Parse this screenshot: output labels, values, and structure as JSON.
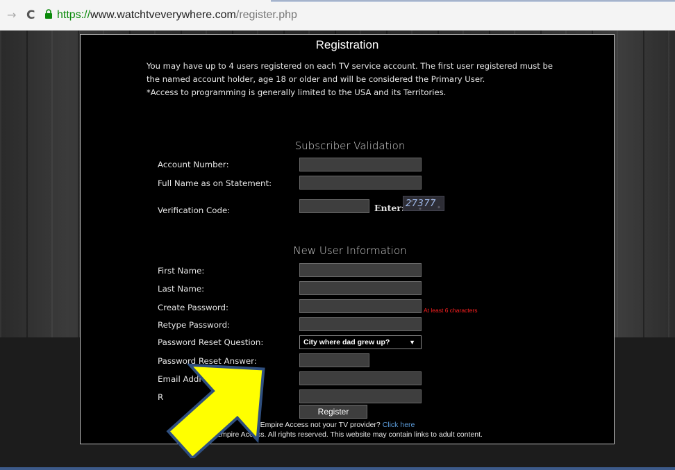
{
  "browser": {
    "url_protocol": "https://",
    "url_host": "www.watchtveverywhere.com",
    "url_path": "/register.php",
    "forward_glyph": "→",
    "reload_glyph": "C",
    "lock_icon": "lock-icon"
  },
  "page": {
    "title": "Registration",
    "intro_lines": [
      "You may have up to 4 users registered on each TV service account. The first user registered must be",
      "the named account holder, age 18 or older and will be considered the Primary User.",
      "*Access to programming is generally limited to the USA and its Territories."
    ],
    "subscriber_section": {
      "heading": "Subscriber Validation",
      "account_number_label": "Account Number:",
      "account_number_value": "",
      "full_name_label": "Full Name as on Statement:",
      "full_name_value": "",
      "verification_label": "Verification Code:",
      "verification_value": "",
      "enter_label": "Enter:",
      "captcha_code": "27377"
    },
    "new_user_section": {
      "heading": "New User Information",
      "first_name_label": "First Name:",
      "last_name_label": "Last Name:",
      "create_password_label": "Create Password:",
      "password_hint": "At least 6 characters",
      "retype_password_label": "Retype Password:",
      "reset_question_label": "Password Reset Question:",
      "reset_question_selected": "City where dad grew up?",
      "reset_answer_label": "Password Reset Answer:",
      "email_label": "Email Address:",
      "retype_email_label": "R"
    },
    "register_button": "Register",
    "footer": {
      "provider_text": "Empire Access not your TV provider?",
      "provider_link": "Click here",
      "copyright": "©2016 Empire Access. All rights reserved. This website may contain links to adult content."
    }
  },
  "annotation": {
    "arrow_color": "#ffff00",
    "arrow_outline": "#2f4f7f"
  }
}
